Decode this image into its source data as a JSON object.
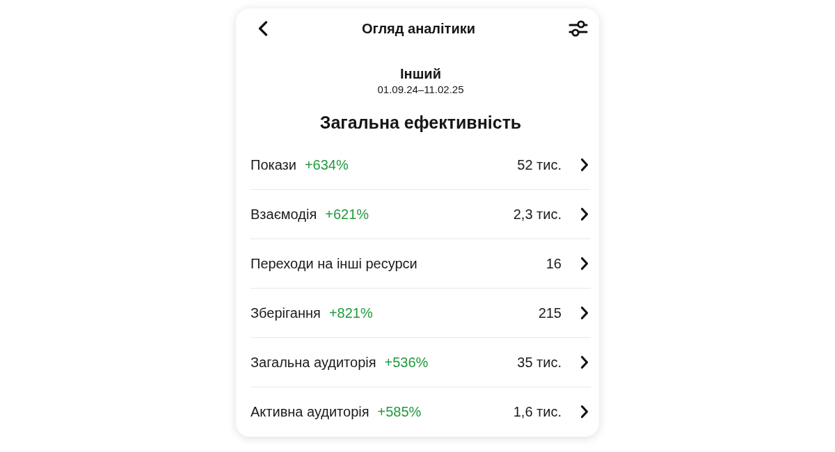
{
  "header": {
    "title": "Огляд аналітики"
  },
  "period": {
    "name": "Інший",
    "dates": "01.09.24–11.02.25"
  },
  "section": {
    "title": "Загальна ефективність",
    "metrics": [
      {
        "label": "Покази",
        "change": "+634%",
        "value": "52 тис."
      },
      {
        "label": "Взаємодія",
        "change": "+621%",
        "value": "2,3 тис."
      },
      {
        "label": "Переходи на інші ресурси",
        "value": "16"
      },
      {
        "label": "Зберігання",
        "change": "+821%",
        "value": "215"
      },
      {
        "label": "Загальна аудиторія",
        "change": "+536%",
        "value": "35 тис."
      },
      {
        "label": "Активна аудиторія",
        "change": "+585%",
        "value": "1,6 тис."
      }
    ]
  }
}
